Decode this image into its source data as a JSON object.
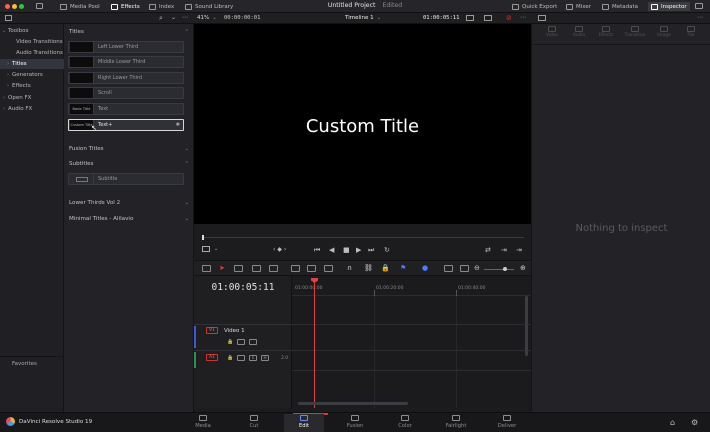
{
  "topbar": {
    "project_title": "Untitled Project",
    "project_status": "Edited",
    "left_buttons": [
      "Media Pool",
      "Effects",
      "Index",
      "Sound Library"
    ],
    "right_buttons": [
      "Quick Export",
      "Mixer",
      "Metadata",
      "Inspector"
    ]
  },
  "viewer_bar": {
    "zoom": "41%",
    "source_tc": "00:00:00:01",
    "timeline_name": "Timeline 1",
    "record_tc": "01:00:05:11"
  },
  "toolbox": {
    "items": [
      {
        "label": "Toolbox",
        "arrow": "⌄"
      },
      {
        "label": "Video Transitions",
        "arrow": ""
      },
      {
        "label": "Audio Transitions",
        "arrow": ""
      },
      {
        "label": "Titles",
        "arrow": "›"
      },
      {
        "label": "Generators",
        "arrow": "›"
      },
      {
        "label": "Effects",
        "arrow": "›"
      },
      {
        "label": "Open FX",
        "arrow": "›"
      },
      {
        "label": "Audio FX",
        "arrow": "›"
      }
    ],
    "favorites": "Favorites"
  },
  "titles_panel": {
    "header": "Titles",
    "tiles": [
      {
        "name": "Left Lower Third",
        "thumb": ""
      },
      {
        "name": "Middle Lower Third",
        "thumb": ""
      },
      {
        "name": "Right Lower Third",
        "thumb": ""
      },
      {
        "name": "Scroll",
        "thumb": ""
      },
      {
        "name": "Text",
        "thumb": "Basic Title"
      },
      {
        "name": "Text+",
        "thumb": "Custom Title"
      }
    ],
    "fusion_titles": "Fusion Titles",
    "subtitles": "Subtitles",
    "subtitle_tile": "Subtitle",
    "lower_thirds": "Lower Thirds Vol 2",
    "minimal_titles": "Minimal Titles - Alilavio"
  },
  "viewer": {
    "title_text": "Custom Title"
  },
  "timeline": {
    "timecode": "01:00:05:11",
    "ruler": [
      "01:00:00:00",
      "01:00:20:00",
      "01:00:40:00"
    ],
    "video_track": {
      "id": "V1",
      "name": "Video 1"
    },
    "audio_track": {
      "id": "A1",
      "level": "2.0"
    }
  },
  "inspector": {
    "tabs": [
      "Video",
      "Audio",
      "Effects",
      "Transition",
      "Image",
      "File"
    ],
    "empty": "Nothing to inspect"
  },
  "bottom": {
    "app_name": "DaVinci Resolve Studio 19",
    "pages": [
      "Media",
      "Cut",
      "Edit",
      "Fusion",
      "Color",
      "Fairlight",
      "Deliver"
    ],
    "active_page": "Edit"
  }
}
